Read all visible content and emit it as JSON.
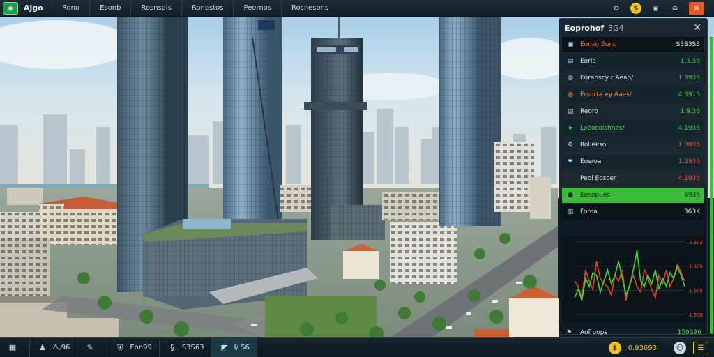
{
  "topbar": {
    "logo_icon": "city-logo-icon",
    "title": "Ajgo",
    "menu": [
      "Rono",
      "Esonb",
      "Rosnsols",
      "Ronostos",
      "Peornos",
      "Rosnesons"
    ],
    "icons": [
      "settings-icon",
      "coin-icon",
      "globe-icon",
      "recycle-icon",
      "close-icon"
    ]
  },
  "panel": {
    "title": "Eoprohof",
    "title_suffix": "3G4",
    "rows": [
      {
        "icon": "wallet-icon",
        "label": "Eonso Eunc",
        "value": "S3S3S3",
        "style": "header"
      },
      {
        "icon": "document-icon",
        "label": "Eoria",
        "value": "1.3.36",
        "style": "stripe",
        "tone": "pos"
      },
      {
        "icon": "globe-icon",
        "label": "Eoranscy r Aeao/",
        "value": "1.3936",
        "style": "",
        "tone": "pos"
      },
      {
        "icon": "globe-icon",
        "label": "Ersorta ey Aaes/",
        "value": "4.3915",
        "style": "stripe",
        "tone": "pos",
        "label_tone": "orange"
      },
      {
        "icon": "document-icon",
        "label": "Reoro",
        "value": "1.9.36",
        "style": "",
        "tone": "pos"
      },
      {
        "icon": "leaf-icon",
        "label": "Loeocoishnos/",
        "value": "4.1936",
        "style": "stripe",
        "tone": "pos",
        "label_tone": "green"
      },
      {
        "icon": "gear-icon",
        "label": "Roliekso",
        "value": "1.3836",
        "style": "",
        "tone": "neg"
      },
      {
        "icon": "heart-icon",
        "label": "Eosroa",
        "value": "1.3936",
        "style": "stripe",
        "tone": "neg"
      },
      {
        "icon": "",
        "label": "Peol Eoscer",
        "value": "4.1936",
        "style": "",
        "tone": "neg"
      },
      {
        "icon": "coin-icon",
        "label": "Eosopuns",
        "value": "6936",
        "style": "highlight"
      },
      {
        "icon": "chart-icon",
        "label": "Foroa",
        "value": "363K",
        "style": "header2"
      }
    ],
    "chart_data": {
      "type": "line",
      "yticks": [
        "3.303",
        "1.920",
        "1.305",
        "1.300"
      ],
      "series": [
        {
          "color": "#e8402a",
          "values": [
            2.2,
            2.0,
            1.6,
            2.6,
            2.2,
            1.9,
            2.9,
            2.3,
            2.1,
            2.0,
            1.7,
            2.4,
            2.2,
            2.6,
            1.5,
            2.1,
            2.4,
            2.0,
            1.8,
            2.6,
            2.3,
            1.9,
            1.6,
            2.4,
            2.1,
            2.6,
            2.0,
            2.3,
            2.8,
            2.5,
            2.2
          ]
        },
        {
          "color": "#3ad73a",
          "values": [
            1.6,
            1.9,
            1.5,
            2.3,
            2.0,
            2.5,
            2.4,
            1.8,
            2.2,
            2.6,
            2.1,
            2.4,
            2.9,
            2.3,
            1.7,
            2.0,
            2.6,
            3.3,
            2.2,
            2.0,
            2.4,
            2.1,
            2.6,
            1.9,
            2.3,
            2.0,
            2.5,
            2.3,
            2.7,
            2.4,
            2.0
          ]
        }
      ],
      "ylim": [
        1.0,
        3.6
      ]
    },
    "footer": {
      "label": "Aof pops",
      "value": "159396",
      "icon": "flag-icon"
    }
  },
  "bottombar": {
    "items": [
      {
        "icon": "grid-icon",
        "label": ""
      },
      {
        "icon": "population-icon",
        "label": "ᗅ,96"
      },
      {
        "icon": "pencil-icon",
        "label": ""
      },
      {
        "icon": "shield-icon",
        "label": "Eon99"
      },
      {
        "icon": "money-icon",
        "label": "S3S63"
      },
      {
        "icon": "cube-icon",
        "label": "I/ S6"
      }
    ],
    "money": "0.93693",
    "coin_icon": "coin-icon",
    "avatar_icon": "avatar-icon",
    "menu_icon": "menu-icon"
  }
}
